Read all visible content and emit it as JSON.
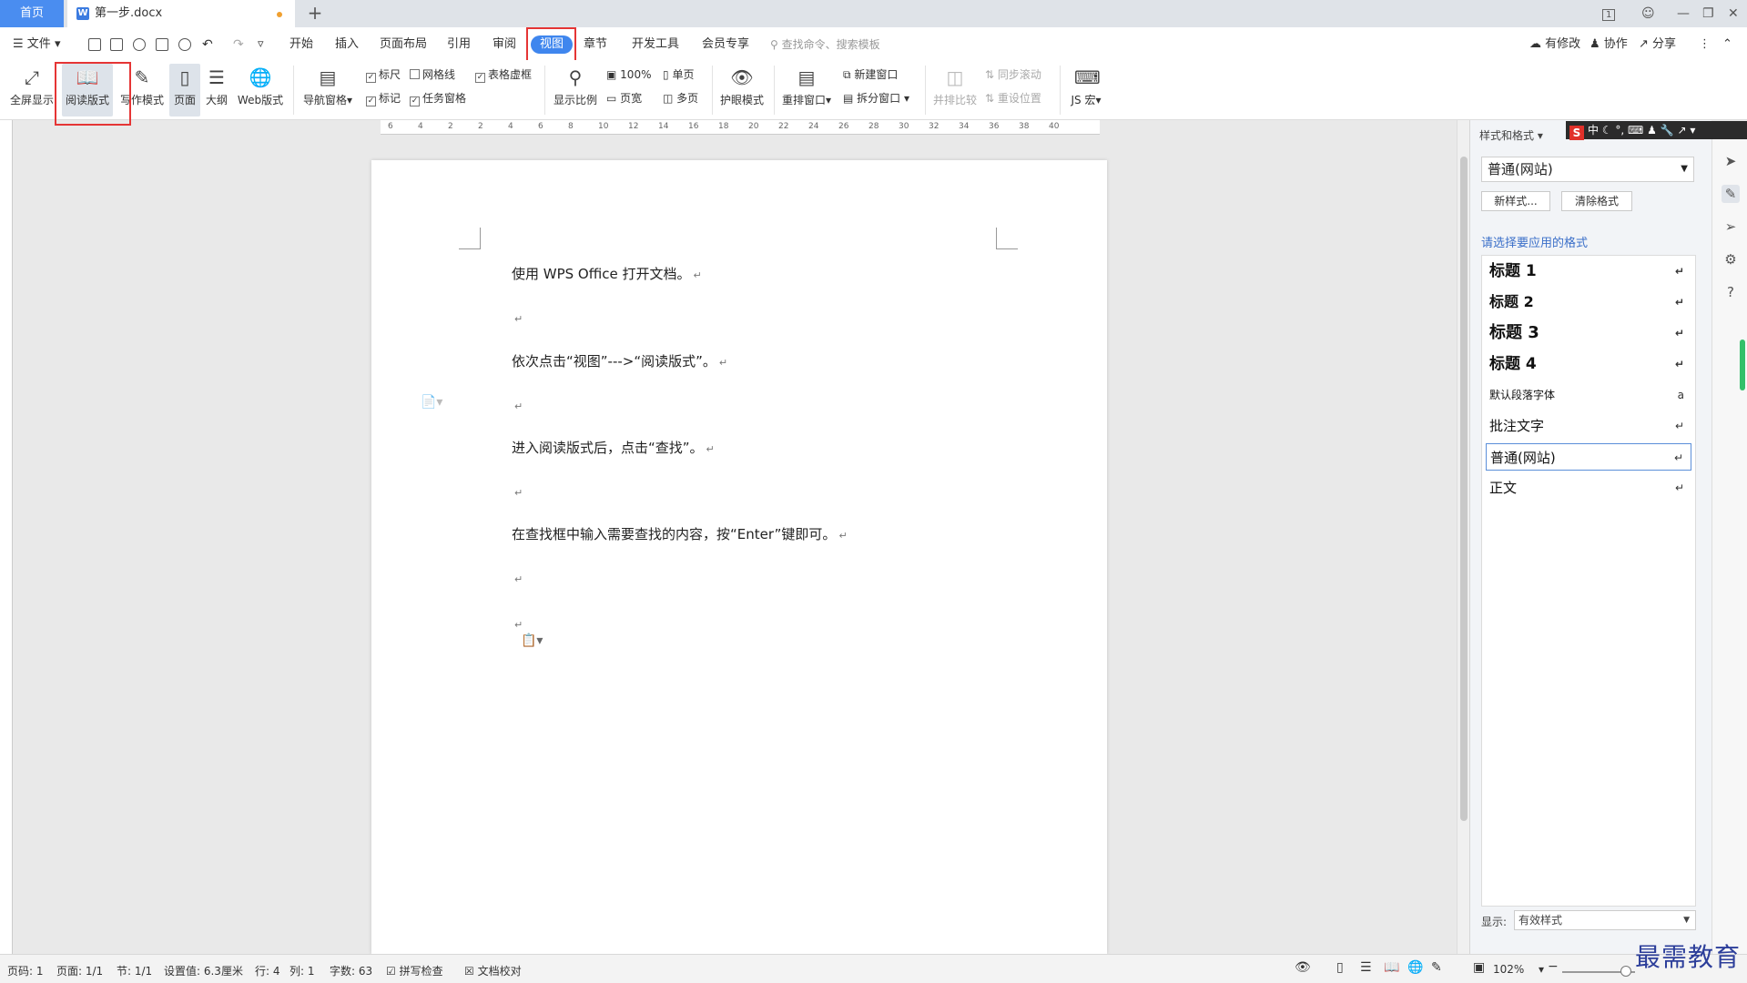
{
  "titlebar": {
    "home_tab": "首页",
    "doc_tab": "第一步.docx",
    "new_tab": "+",
    "badge": "1"
  },
  "menu": {
    "file": "文件",
    "tabs": [
      "开始",
      "插入",
      "页面布局",
      "引用",
      "审阅",
      "视图",
      "章节",
      "开发工具",
      "会员专享"
    ],
    "active_tab": "视图",
    "search_placeholder": "查找命令、搜索模板",
    "right": {
      "changes": "有修改",
      "collab": "协作",
      "share": "分享"
    }
  },
  "ribbon": {
    "fullscreen": "全屏显示",
    "reading": "阅读版式",
    "writing": "写作模式",
    "page": "页面",
    "outline": "大纲",
    "web": "Web版式",
    "nav_pane": "导航窗格",
    "ruler": "标尺",
    "gridlines": "网格线",
    "table_virtual": "表格虚框",
    "marks": "标记",
    "task_pane": "任务窗格",
    "zoom": "显示比例",
    "zoom_100": "100%",
    "single_page": "单页",
    "page_width": "页宽",
    "multi_page": "多页",
    "eye_mode": "护眼模式",
    "rearrange": "重排窗口",
    "new_window": "新建窗口",
    "split_window": "拆分窗口",
    "compare": "并排比较",
    "sync_scroll": "同步滚动",
    "reset_pos": "重设位置",
    "js_macro": "JS 宏"
  },
  "ruler": {
    "ticks": [
      "6",
      "4",
      "2",
      "2",
      "4",
      "6",
      "8",
      "10",
      "12",
      "14",
      "16",
      "18",
      "20",
      "22",
      "24",
      "26",
      "28",
      "30",
      "32",
      "34",
      "36",
      "38",
      "40"
    ]
  },
  "document": {
    "paragraphs": [
      "使用 WPS Office 打开文档。",
      "依次点击“视图”--->“阅读版式”。",
      "进入阅读版式后，点击“查找”。",
      "在查找框中输入需要查找的内容，按“Enter”键即可。"
    ],
    "para_mark": "↵"
  },
  "sidepanel": {
    "title": "样式和格式",
    "current_style": "普通(网站)",
    "new_style": "新样式...",
    "clear_format": "清除格式",
    "hint": "请选择要应用的格式",
    "styles": [
      {
        "name": "标题  1",
        "ret": "↵"
      },
      {
        "name": "标题  2",
        "ret": "↵"
      },
      {
        "name": "标题  3",
        "ret": "↵"
      },
      {
        "name": "标题  4",
        "ret": "↵"
      },
      {
        "name": "默认段落字体",
        "ret": "a"
      },
      {
        "name": "批注文字",
        "ret": "↵"
      },
      {
        "name": "普通(网站)",
        "ret": "↵"
      },
      {
        "name": "正文",
        "ret": "↵"
      }
    ],
    "show_label": "显示:",
    "show_value": "有效样式"
  },
  "imebar": {
    "logo": "S",
    "lang": "中"
  },
  "status": {
    "page_code": "页码: 1",
    "page": "页面: 1/1",
    "section": "节: 1/1",
    "setting": "设置值: 6.3厘米",
    "row": "行: 4",
    "col": "列: 1",
    "words": "字数: 63",
    "spell": "拼写检查",
    "proof": "文档校对",
    "zoom": "102%"
  },
  "watermark": "最需教育"
}
